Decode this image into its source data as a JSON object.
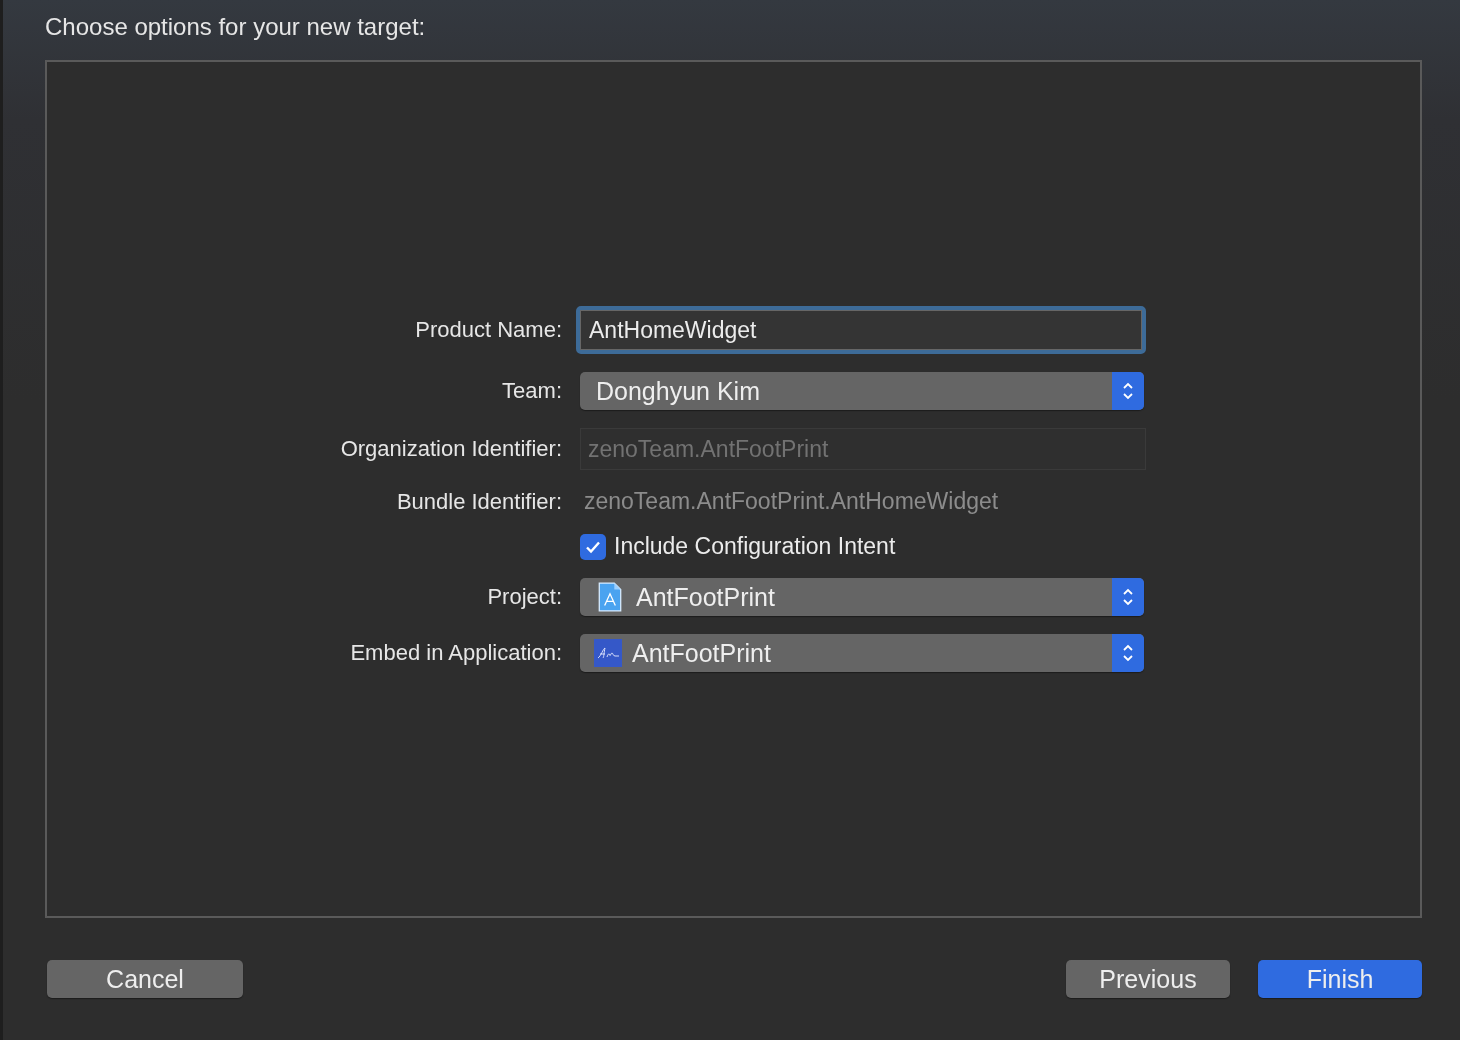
{
  "heading": "Choose options for your new target:",
  "form": [
    {
      "kind": "text-field",
      "label": "Product Name:",
      "value": "AntHomeWidget",
      "focused": true
    },
    {
      "kind": "popup",
      "label": "Team:",
      "value": "Donghyun Kim"
    },
    {
      "kind": "disabled-field",
      "label": "Organization Identifier:",
      "placeholder": "zenoTeam.AntFootPrint"
    },
    {
      "kind": "static",
      "label": "Bundle Identifier:",
      "value": "zenoTeam.AntFootPrint.AntHomeWidget"
    },
    {
      "kind": "checkbox",
      "value": "Include Configuration Intent",
      "checked": true
    },
    {
      "kind": "document-popup",
      "label": "Project:",
      "value": "AntFootPrint"
    },
    {
      "kind": "app-popup",
      "label": "Embed in Application:",
      "value": "AntFootPrint"
    }
  ],
  "buttons": [
    {
      "label": "Cancel",
      "default": false
    },
    {
      "label": "Previous",
      "default": false
    },
    {
      "label": "Finish",
      "default": true
    }
  ]
}
